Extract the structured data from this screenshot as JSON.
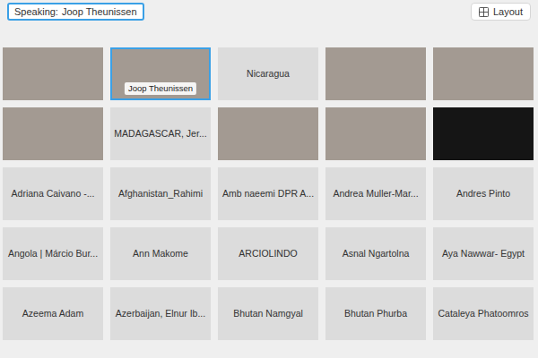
{
  "speaking": {
    "prefix": "Speaking:",
    "name": "Joop Theunissen"
  },
  "layout_button": "Layout",
  "tiles": [
    {
      "kind": "video",
      "name": "",
      "selected": false
    },
    {
      "kind": "video",
      "name": "Joop Theunissen",
      "selected": true
    },
    {
      "kind": "name",
      "name": "Nicaragua",
      "selected": false
    },
    {
      "kind": "video",
      "name": "",
      "selected": false
    },
    {
      "kind": "video",
      "name": "",
      "selected": false
    },
    {
      "kind": "video",
      "name": "",
      "selected": false
    },
    {
      "kind": "name",
      "name": "MADAGASCAR, Jer...",
      "selected": false
    },
    {
      "kind": "video",
      "name": "",
      "selected": false
    },
    {
      "kind": "video",
      "name": "",
      "selected": false
    },
    {
      "kind": "dark",
      "name": "",
      "selected": false
    },
    {
      "kind": "name",
      "name": "Adriana Caivano -...",
      "selected": false
    },
    {
      "kind": "name",
      "name": "Afghanistan_Rahimi",
      "selected": false
    },
    {
      "kind": "name",
      "name": "Amb naeemi DPR A...",
      "selected": false
    },
    {
      "kind": "name",
      "name": "Andrea Muller-Mar...",
      "selected": false
    },
    {
      "kind": "name",
      "name": "Andres Pinto",
      "selected": false
    },
    {
      "kind": "name",
      "name": "Angola | Márcio Bur...",
      "selected": false
    },
    {
      "kind": "name",
      "name": "Ann Makome",
      "selected": false
    },
    {
      "kind": "name",
      "name": "ARCIOLINDO",
      "selected": false
    },
    {
      "kind": "name",
      "name": "Asnal Ngartolna",
      "selected": false
    },
    {
      "kind": "name",
      "name": "Aya Nawwar- Egypt",
      "selected": false
    },
    {
      "kind": "name",
      "name": "Azeema Adam",
      "selected": false
    },
    {
      "kind": "name",
      "name": "Azerbaijan, Elnur Ib...",
      "selected": false
    },
    {
      "kind": "name",
      "name": "Bhutan Namgyal",
      "selected": false
    },
    {
      "kind": "name",
      "name": "Bhutan Phurba",
      "selected": false
    },
    {
      "kind": "name",
      "name": "Cataleya Phatoomros",
      "selected": false
    }
  ]
}
